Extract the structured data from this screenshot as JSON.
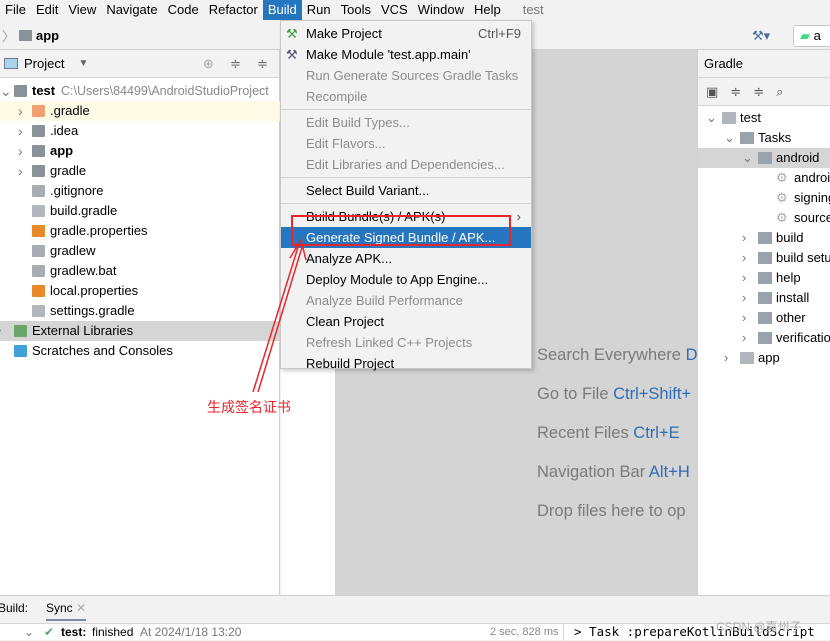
{
  "menubar": {
    "items": [
      "File",
      "Edit",
      "View",
      "Navigate",
      "Code",
      "Refactor",
      "Build",
      "Run",
      "Tools",
      "VCS",
      "Window",
      "Help"
    ],
    "active": "Build",
    "project_title": "test"
  },
  "navbar": {
    "breadcrumb": "app"
  },
  "project_panel": {
    "view_label": "Project",
    "tree": [
      {
        "label": "test",
        "path": "C:\\Users\\84499\\AndroidStudioProject",
        "bold": true,
        "icon": "module-folder-icon"
      },
      {
        "label": ".gradle",
        "icon": "folder-orange-icon"
      },
      {
        "label": ".idea",
        "icon": "folder-icon"
      },
      {
        "label": "app",
        "bold": true,
        "icon": "module-folder-icon"
      },
      {
        "label": "gradle",
        "icon": "folder-icon"
      },
      {
        "label": ".gitignore",
        "icon": "ignore-file-icon"
      },
      {
        "label": "build.gradle",
        "icon": "gradle-elephant-icon"
      },
      {
        "label": "gradle.properties",
        "icon": "properties-file-icon"
      },
      {
        "label": "gradlew",
        "icon": "shell-file-icon"
      },
      {
        "label": "gradlew.bat",
        "icon": "text-file-icon"
      },
      {
        "label": "local.properties",
        "icon": "properties-file-icon"
      },
      {
        "label": "settings.gradle",
        "icon": "gradle-elephant-icon"
      },
      {
        "label": "External Libraries",
        "icon": "library-icon"
      },
      {
        "label": "Scratches and Consoles",
        "icon": "scratches-icon"
      }
    ]
  },
  "build_menu": {
    "items": [
      {
        "label": "Make Project",
        "shortcut": "Ctrl+F9",
        "enabled": true
      },
      {
        "label": "Make Module 'test.app.main'",
        "enabled": true
      },
      {
        "label": "Run Generate Sources Gradle Tasks",
        "enabled": false
      },
      {
        "label": "Recompile",
        "enabled": false
      },
      {
        "label": "Edit Build Types...",
        "enabled": false
      },
      {
        "label": "Edit Flavors...",
        "enabled": false
      },
      {
        "label": "Edit Libraries and Dependencies...",
        "enabled": false
      },
      {
        "label": "Select Build Variant...",
        "enabled": true
      },
      {
        "label": "Build Bundle(s) / APK(s)",
        "enabled": true,
        "submenu": true
      },
      {
        "label": "Generate Signed Bundle / APK...",
        "enabled": true,
        "selected": true
      },
      {
        "label": "Analyze APK...",
        "enabled": true
      },
      {
        "label": "Deploy Module to App Engine...",
        "enabled": true
      },
      {
        "label": "Analyze Build Performance",
        "enabled": false
      },
      {
        "label": "Clean Project",
        "enabled": true
      },
      {
        "label": "Refresh Linked C++ Projects",
        "enabled": false
      },
      {
        "label": "Rebuild Project",
        "enabled": true
      }
    ]
  },
  "editor_hints": [
    {
      "text": "Search Everywhere",
      "key": "D"
    },
    {
      "text": "Go to File",
      "key": "Ctrl+Shift+"
    },
    {
      "text": "Recent Files",
      "key": "Ctrl+E"
    },
    {
      "text": "Navigation Bar",
      "key": "Alt+H"
    },
    {
      "text": "Drop files here to op",
      "key": ""
    }
  ],
  "gradle_panel": {
    "title": "Gradle",
    "tree": [
      {
        "label": "test",
        "level": 0,
        "icon": "gradle-elephant-icon",
        "open": true
      },
      {
        "label": "Tasks",
        "level": 1,
        "icon": "task-folder-icon",
        "open": true
      },
      {
        "label": "android",
        "level": 2,
        "icon": "task-folder-icon",
        "open": true,
        "selected": true
      },
      {
        "label": "androi",
        "level": 3,
        "icon": "gear-icon"
      },
      {
        "label": "signing",
        "level": 3,
        "icon": "gear-icon"
      },
      {
        "label": "source",
        "level": 3,
        "icon": "gear-icon"
      },
      {
        "label": "build",
        "level": 2,
        "icon": "task-folder-icon"
      },
      {
        "label": "build setu",
        "level": 2,
        "icon": "task-folder-icon"
      },
      {
        "label": "help",
        "level": 2,
        "icon": "task-folder-icon"
      },
      {
        "label": "install",
        "level": 2,
        "icon": "task-folder-icon"
      },
      {
        "label": "other",
        "level": 2,
        "icon": "task-folder-icon"
      },
      {
        "label": "verificatio",
        "level": 2,
        "icon": "task-folder-icon"
      },
      {
        "label": "app",
        "level": 1,
        "icon": "gradle-elephant-icon"
      }
    ]
  },
  "run_config": "a",
  "annotation": {
    "text": "生成签名证书",
    "color": "#e8262b"
  },
  "bottom": {
    "build_label": "Build:",
    "tab": "Sync",
    "status_name": "test:",
    "status_text": "finished",
    "status_time": "At 2024/1/18 13:20",
    "duration": "2 sec, 828 ms",
    "console": "> Task :prepareKotlinBuildScript",
    "watermark": "CSDN @嘉州子"
  },
  "colors": {
    "accent": "#2675bf",
    "annotation": "#e8262b",
    "success": "#59a869"
  }
}
